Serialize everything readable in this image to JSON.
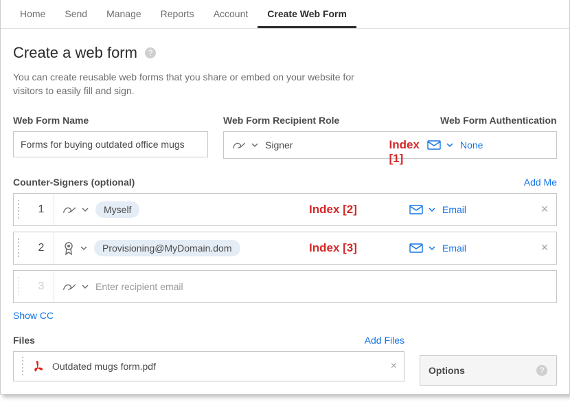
{
  "nav": {
    "items": [
      "Home",
      "Send",
      "Manage",
      "Reports",
      "Account",
      "Create Web Form"
    ],
    "active_index": 5
  },
  "header": {
    "title": "Create a web form",
    "desc": "You can create reusable web forms that you share or embed on your website for visitors to easily fill and sign."
  },
  "labels": {
    "name": "Web Form Name",
    "role": "Web Form Recipient Role",
    "auth": "Web Form Authentication"
  },
  "form": {
    "name_value": "Forms for buying outdated office mugs",
    "role_value": "Signer",
    "auth_value": "None"
  },
  "annotations": {
    "i1": "Index [1]",
    "i2": "Index [2]",
    "i3": "Index [3]"
  },
  "counter": {
    "title": "Counter-Signers (optional)",
    "add_me": "Add Me",
    "rows": [
      {
        "order": "1",
        "pill": "Myself",
        "auth": "Email"
      },
      {
        "order": "2",
        "pill": "Provisioning@MyDomain.dom",
        "auth": "Email"
      },
      {
        "order": "3",
        "placeholder": "Enter recipient email"
      }
    ],
    "show_cc": "Show CC"
  },
  "files": {
    "title": "Files",
    "add": "Add Files",
    "file": "Outdated mugs form.pdf"
  },
  "options": {
    "title": "Options"
  }
}
